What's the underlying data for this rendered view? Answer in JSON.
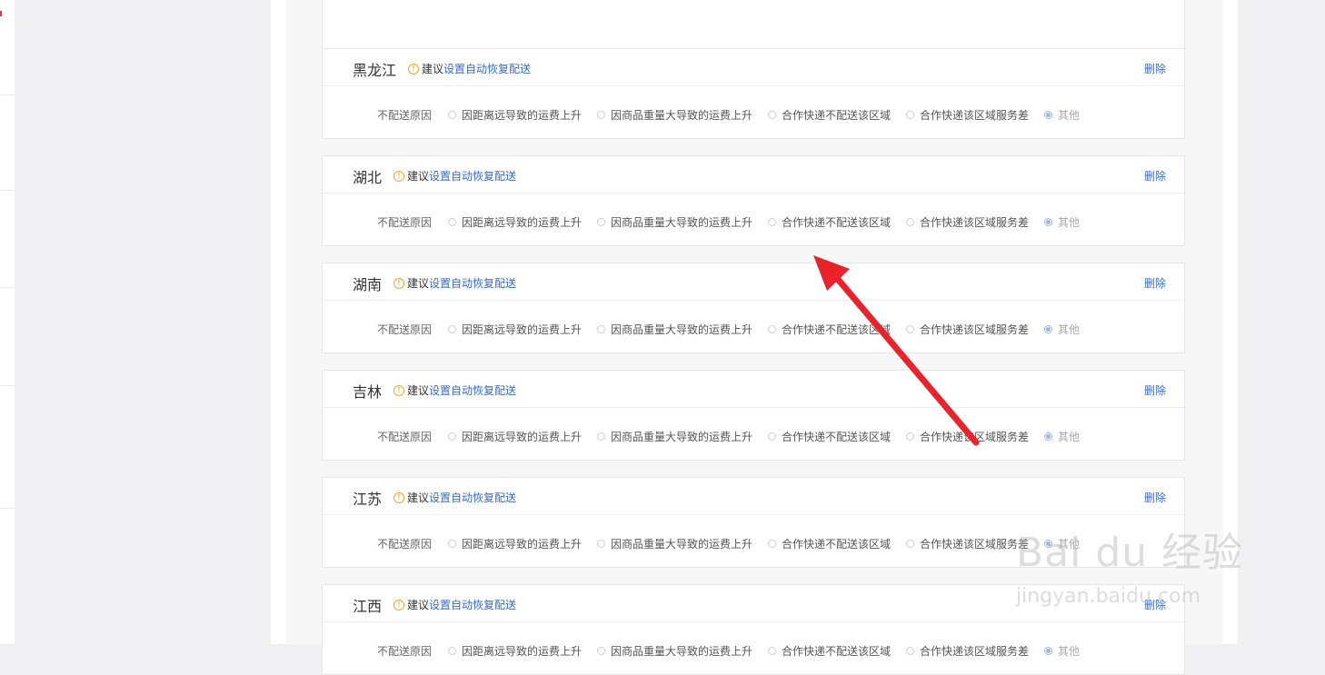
{
  "tip": {
    "prefix": "建议",
    "link": "设置自动恢复配送"
  },
  "reason_label": "不配送原因",
  "delete_label": "删除",
  "options": [
    "因距离远导致的运费上升",
    "因商品重量大导致的运费上升",
    "合作快递不配送该区域",
    "合作快递该区域服务差",
    "其他"
  ],
  "selected_option": "其他",
  "provinces": [
    {
      "name": ""
    },
    {
      "name": "黑龙江"
    },
    {
      "name": "湖北"
    },
    {
      "name": "湖南"
    },
    {
      "name": "吉林"
    },
    {
      "name": "江苏"
    },
    {
      "name": "江西"
    }
  ],
  "watermark": {
    "brand": "Bai du 经验",
    "url": "jingyan.baidu.com"
  },
  "colors": {
    "link": "#3a6bc7",
    "warn": "#f5a623",
    "arrow": "#e8232b",
    "selected_radio": "#9ab6e8"
  }
}
